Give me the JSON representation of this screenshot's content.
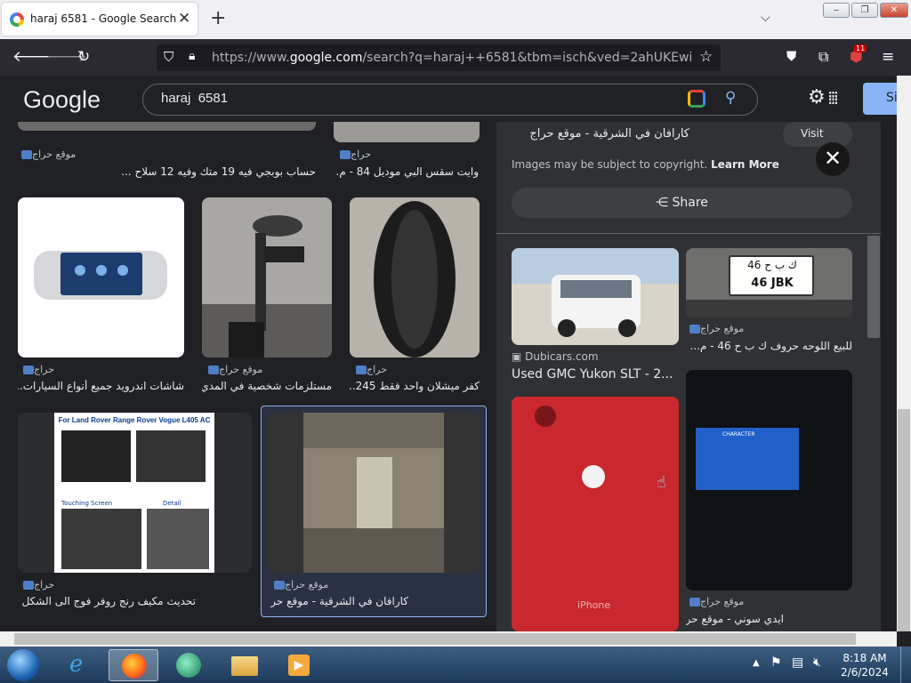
{
  "browser": {
    "tab_title": "haraj 6581 - Google Search",
    "new_tab": "+",
    "url_prefix": "https://www.",
    "url_host": "google.com",
    "url_rest": "/search?q=haraj++6581&tbm=isch&ved=2ahUKEwiHnqinvpaE",
    "extension_badge": "11",
    "window_buttons": {
      "minimize": "‒",
      "maximize": "❐",
      "close": "✕"
    }
  },
  "google": {
    "logo": "Google",
    "query": "haraj  6581",
    "signin_partial": "Si"
  },
  "results": [
    {
      "source": "موقع حراج",
      "title": "حساب بوبجي فيه 19 متك وفيه 12 سلاح ..."
    },
    {
      "source": "حراج",
      "title": "وايت سقس البي موديل 84 - م..."
    },
    {
      "source": "حراج",
      "title": "شاشات اندرويد جميع أنواع السيارات..."
    },
    {
      "source": "موقع حراج",
      "title": "مستلزمات شخصية في المدي..."
    },
    {
      "source": "حراج",
      "title": "كفر ميشلان واحد فقط 245..."
    },
    {
      "source": "حراج",
      "title": "تحديث مكيف رنج روفر فوج الى الشكل ..."
    },
    {
      "source": "موقع حراج",
      "title": "كارافان في الشرقية - موقع حراج"
    }
  ],
  "landrover_ad": {
    "heading": "For Land Rover Range Rover Vogue L405 AC",
    "label1": "Touching Screen",
    "label2": "Detail"
  },
  "panel": {
    "title_partial": "كارافان في الشرقية - موقع حراج",
    "visit": "Visit",
    "copyright": "Images may be subject to copyright.",
    "learn_more": "Learn More",
    "share": "Share",
    "close": "✕",
    "related": [
      {
        "source": "Dubicars.com",
        "title": "Used GMC Yukon SLT - 2..."
      },
      {
        "source": "موقع حراج",
        "title": "للبيع اللوحه حروف ك ب ح 46 - م...",
        "plate_top": "ك ب ح 46",
        "plate_bottom": "46 JBK"
      },
      {
        "source": "",
        "title": "",
        "phone_label": "iPhone"
      },
      {
        "source": "موقع حراج",
        "title": "ايدي سوني - موقع حراج",
        "tv_text": "CHARACTER"
      }
    ]
  },
  "taskbar": {
    "time": "8:18 AM",
    "date": "2/6/2024"
  }
}
